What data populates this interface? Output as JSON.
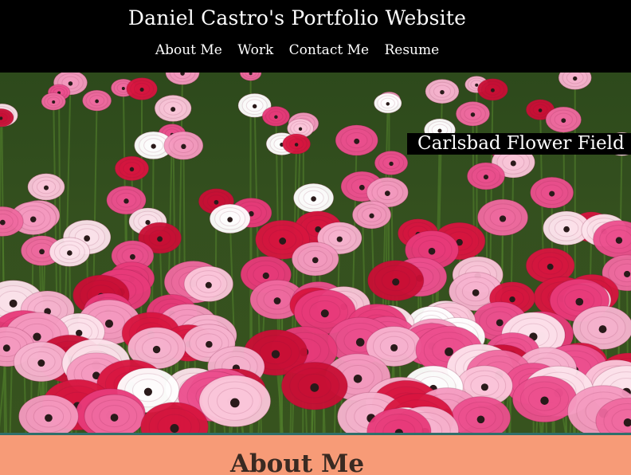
{
  "header": {
    "title": "Daniel Castro's Portfolio Website",
    "nav": [
      {
        "label": "About Me"
      },
      {
        "label": "Work"
      },
      {
        "label": "Contact Me"
      },
      {
        "label": "Resume"
      }
    ]
  },
  "hero": {
    "caption": "Carlsbad Flower Field",
    "image_subject": "field of pink, white and red ranunculus flowers"
  },
  "about": {
    "heading": "About Me"
  },
  "colors": {
    "header_bg": "#000000",
    "header_text": "#ffffff",
    "section_bg": "#f79b77",
    "divider": "#2f6f6a",
    "heading_text": "#3a2a22"
  }
}
